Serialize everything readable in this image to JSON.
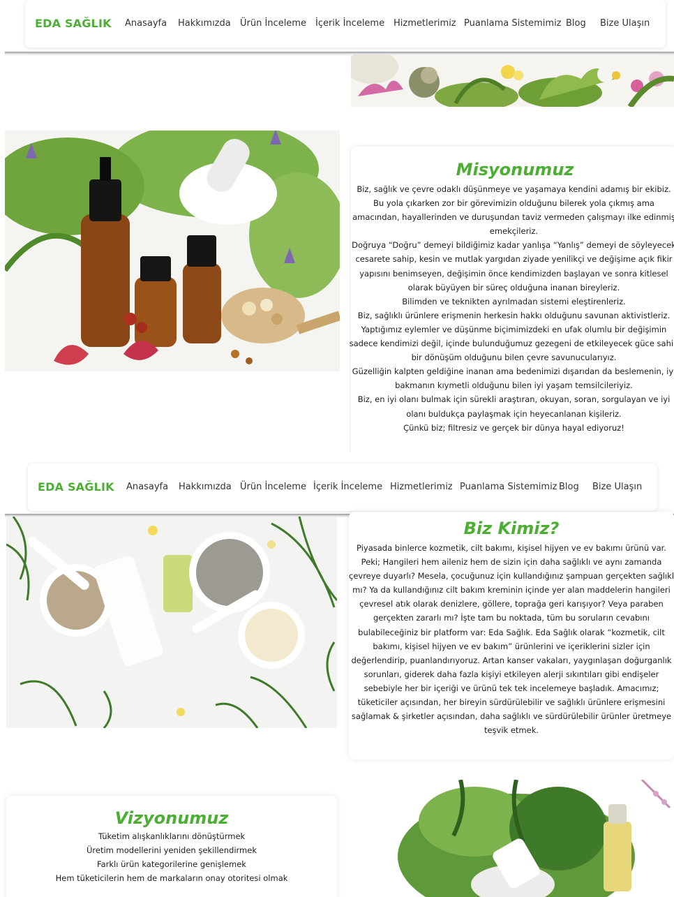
{
  "nav": {
    "brand": "EDA SAĞLIK",
    "items": [
      "Anasayfa",
      "Hakkımızda",
      "Ürün İnceleme",
      "İçerik İnceleme",
      "Hizmetlerimiz",
      "Puanlama Sistemimiz",
      "Blog",
      "Bize Ulaşın"
    ]
  },
  "mission": {
    "title": "Misyonumuz",
    "lines": [
      "Biz, sağlık ve çevre odaklı düşünmeye ve yaşamaya kendini adamış bir ekibiz.",
      "Bu yola çıkarken zor bir görevimizin olduğunu bilerek yola çıkmış ama",
      "amacından, hayallerinden ve duruşundan taviz vermeden çalışmayı ilke edinmiş",
      "emekçileriz.",
      "Doğruya “Doğru” demeyi bildiğimiz kadar yanlışa “Yanlış” demeyi de söyleyecek",
      "cesarete sahip, kesin ve mutlak yargıdan ziyade yenilikçi ve değişime açık fikir",
      "yapısını benimseyen, değişimin önce kendimizden başlayan ve sonra kitlesel",
      "olarak büyüyen bir süreç olduğuna inanan bireyleriz.",
      "Bilimden ve teknikten ayrılmadan sistemi eleştirenleriz.",
      "Biz, sağlıklı ürünlere erişmenin herkesin hakkı olduğunu savunan aktivistleriz.",
      "Yaptığımız eylemler ve düşünme biçimimizdeki en ufak olumlu bir değişimin",
      "sadece kendimizi değil, içinde bulunduğumuz gezegeni de etkileyecek güce sahip",
      "bir dönüşüm olduğunu bilen çevre savunucularıyız.",
      "Güzelliğin kalpten geldiğine inanan ama bedenimizi dışarıdan da beslemenin, iyi",
      "bakmanın kıymetli olduğunu bilen iyi yaşam temsilcileriyiz.",
      "Biz, en iyi olanı bulmak için sürekli araştıran, okuyan, soran, sorgulayan ve iyi",
      "olanı buldukça paylaşmak için heyecanlanan kişileriz.",
      "Çünkü biz; filtresiz ve gerçek bir dünya hayal ediyoruz!"
    ]
  },
  "about": {
    "title": "Biz Kimiz?",
    "lines": [
      "Piyasada binlerce kozmetik, cilt bakımı, kişisel hijyen ve ev bakımı ürünü var.",
      "Peki; Hangileri hem aileniz hem de sizin için daha sağlıklı ve aynı zamanda",
      "çevreye duyarlı? Mesela, çocuğunuz için kullandığınız şampuan gerçekten sağlıklı",
      "mı? Ya da kullandığınız cilt bakım kreminin içinde yer alan maddelerin hangileri",
      "çevresel atık olarak denizlere, göllere, toprağa geri karışıyor? Veya paraben",
      "gerçekten zararlı mı? İşte tam bu noktada, tüm bu soruların cevabını",
      "bulabileceğiniz bir platform var: Eda Sağlık. Eda Sağlık olarak “kozmetik, cilt",
      "bakımı, kişisel hijyen ve ev bakım” ürünlerini ve içeriklerini sizler için",
      "değerlendirip, puanlandırıyoruz. Artan kanser vakaları, yaygınlaşan doğurganlık",
      "sorunları, giderek daha fazla kişiyi etkileyen alerji sıkıntıları gibi endişeler",
      "sebebiyle her bir içeriği ve ürünü tek tek incelemeye başladık. Amacımız;",
      "tüketiciler açısından, her bireyin sürdürülebilir ve sağlıklı ürünlere erişmesini",
      "sağlamak & şirketler açısından, daha sağlıklı ve sürdürülebilir ürünler üretmeye",
      "teşvik etmek."
    ]
  },
  "vision": {
    "title": "Vizyonumuz",
    "lines": [
      "Tüketim alışkanlıklarını dönüştürmek",
      "Üretim modellerini yeniden şekillendirmek",
      "Farklı ürün kategorilerine genişlemek",
      "Hem tüketicilerin hem de markaların onay otoritesi olmak"
    ]
  },
  "colors": {
    "brand": "#4caf34",
    "text": "#1d1d1d"
  }
}
